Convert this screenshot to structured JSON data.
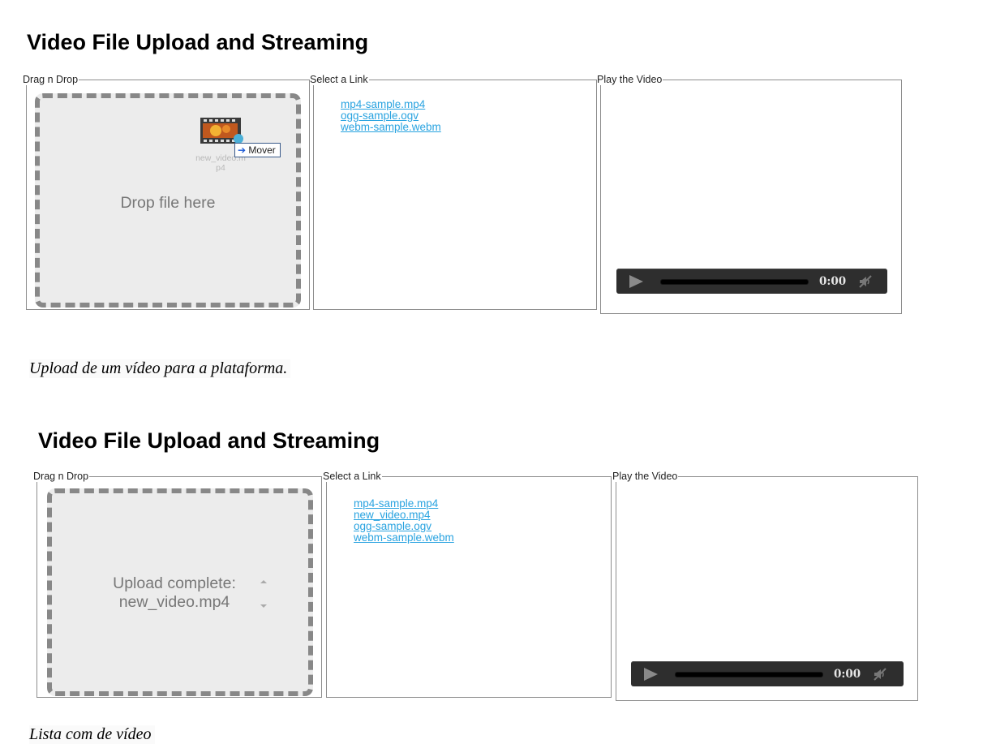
{
  "screens": [
    {
      "title": "Video File Upload and Streaming",
      "drag_legend": "Drag n Drop",
      "drop_text": "Drop file here",
      "dragging_file": {
        "label_line1": "new_video.m",
        "label_line2": "p4",
        "icon": "video-file-icon"
      },
      "tooltip": "Mover",
      "link_legend": "Select a Link",
      "links": [
        "mp4-sample.mp4",
        "ogg-sample.ogv",
        "webm-sample.webm"
      ],
      "play_legend": "Play the Video",
      "player_time": "0:00",
      "caption": "Upload de um vídeo para a plataforma."
    },
    {
      "title": "Video File Upload and Streaming",
      "drag_legend": "Drag n Drop",
      "drop_text_line1": "Upload complete:",
      "drop_text_line2": "new_video.mp4",
      "link_legend": "Select a Link",
      "links": [
        "mp4-sample.mp4",
        "new_video.mp4",
        "ogg-sample.ogv",
        "webm-sample.webm"
      ],
      "play_legend": "Play the Video",
      "player_time": "0:00",
      "caption": "Lista com de vídeo"
    }
  ],
  "colors": {
    "link": "#29a3e0",
    "dropzone_bg": "#ececec",
    "dash": "#888888",
    "player_bg": "#2e2e2e"
  }
}
